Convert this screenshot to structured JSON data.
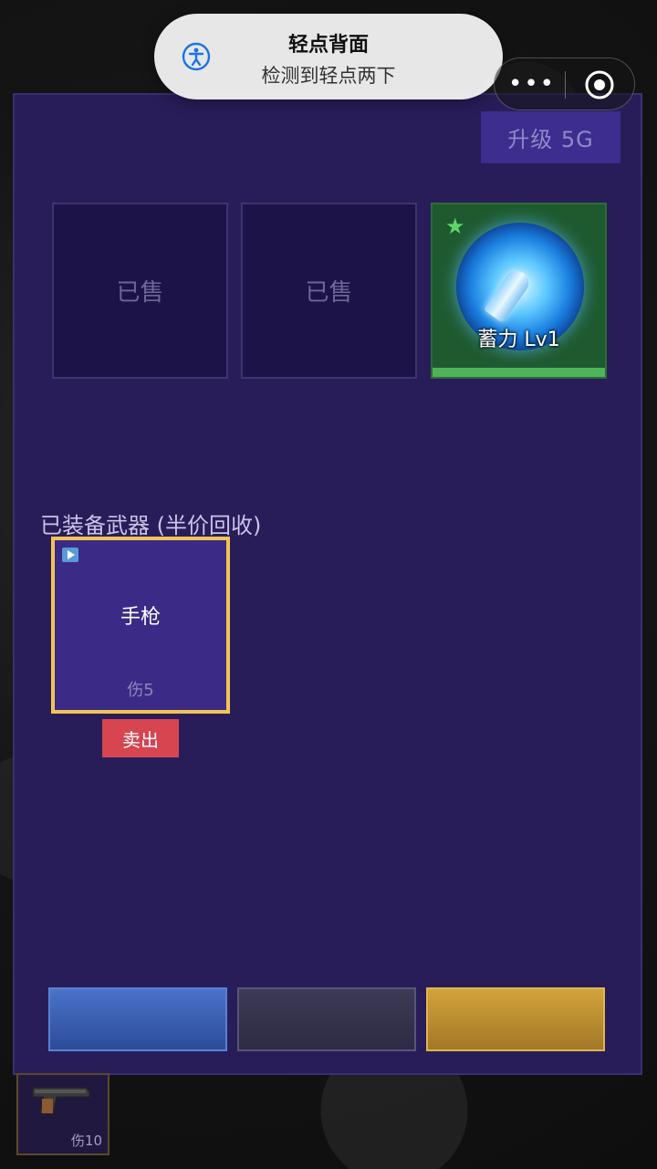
{
  "toast": {
    "title": "轻点背面",
    "subtitle": "检测到轻点两下",
    "icon": "accessibility-icon"
  },
  "capsule": {
    "more_label": "•••",
    "close_icon": "target-close-icon"
  },
  "shop": {
    "upgrade_label": "升级 5G",
    "slots": [
      {
        "label": "已售"
      },
      {
        "label": "已售"
      },
      {
        "label": "蓄力 Lv1",
        "icon": "charged-bullet-icon",
        "rarity_icon": "star-icon"
      }
    ]
  },
  "equipped": {
    "title": "已装备武器 (半价回收)",
    "weapons": [
      {
        "name": "手枪",
        "damage": "伤5",
        "sell_label": "卖出",
        "badge_icon": "play-icon"
      }
    ]
  },
  "bottom_buttons": [
    {
      "color": "#3b5fb3"
    },
    {
      "color": "#35324c"
    },
    {
      "color": "#c39334"
    }
  ],
  "inventory": [
    {
      "damage": "伤10",
      "icon": "pistol-icon"
    }
  ]
}
